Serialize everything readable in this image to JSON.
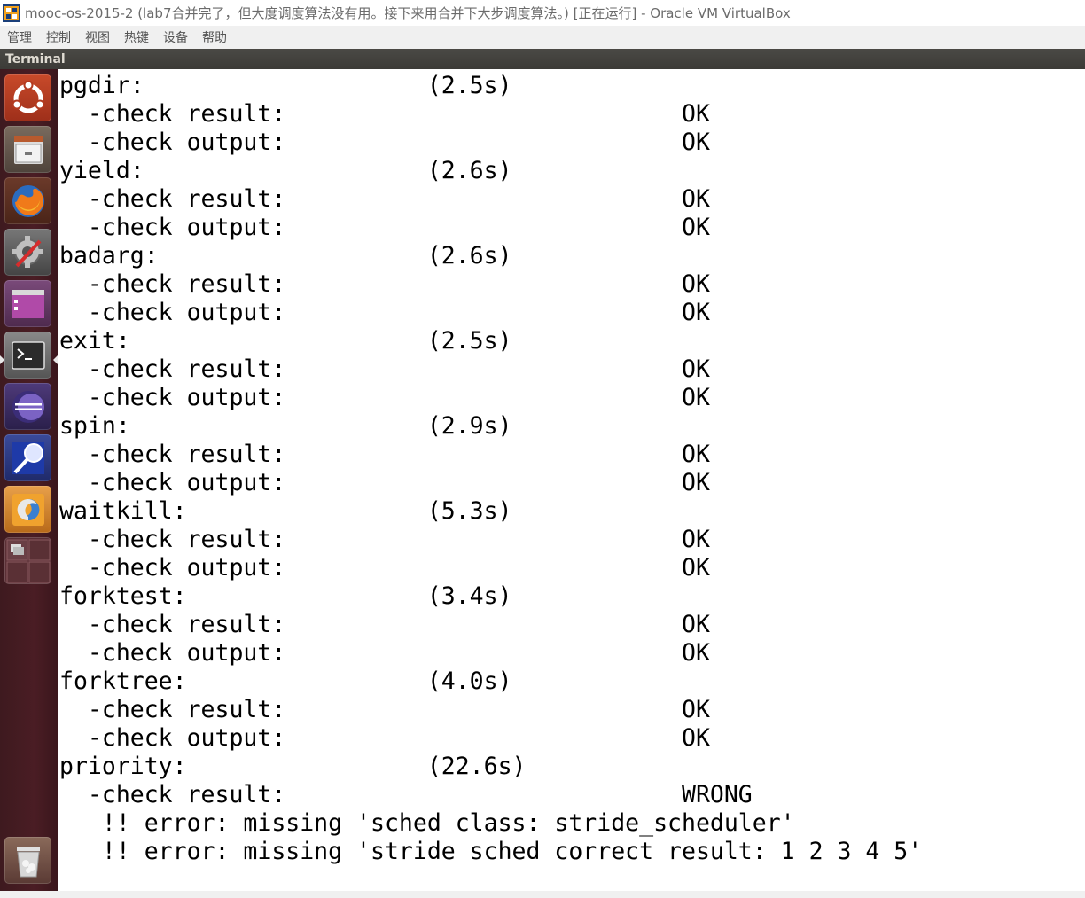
{
  "window": {
    "title": "mooc-os-2015-2 (lab7合并完了，但大度调度算法没有用。接下来用合并下大步调度算法。) [正在运行] - Oracle VM VirtualBox"
  },
  "menubar": {
    "items": [
      "管理",
      "控制",
      "视图",
      "热键",
      "设备",
      "帮助"
    ]
  },
  "guest": {
    "app_name": "Terminal",
    "launcher": [
      {
        "name": "ubuntu-dash-icon",
        "color": "#dd4814"
      },
      {
        "name": "files-icon",
        "color": "#8a8a8a"
      },
      {
        "name": "firefox-icon",
        "color": "#e66000"
      },
      {
        "name": "system-settings-icon",
        "color": "#7a7a7a"
      },
      {
        "name": "workspace-app-icon",
        "color": "#a33fa0"
      },
      {
        "name": "terminal-icon",
        "color": "#2e2e2e"
      },
      {
        "name": "eclipse-icon",
        "color": "#2c2255"
      },
      {
        "name": "code-search-icon",
        "color": "#2a3c9a"
      },
      {
        "name": "meld-icon",
        "color": "#e9902a"
      },
      {
        "name": "workspace-switcher-icon",
        "color": "#5a3a3e"
      },
      {
        "name": "trash-icon",
        "color": "#bbbbbb"
      }
    ]
  },
  "terminal": {
    "lines": [
      "pgdir:                    (2.5s)",
      "  -check result:                            OK",
      "  -check output:                            OK",
      "yield:                    (2.6s)",
      "  -check result:                            OK",
      "  -check output:                            OK",
      "badarg:                   (2.6s)",
      "  -check result:                            OK",
      "  -check output:                            OK",
      "exit:                     (2.5s)",
      "  -check result:                            OK",
      "  -check output:                            OK",
      "spin:                     (2.9s)",
      "  -check result:                            OK",
      "  -check output:                            OK",
      "waitkill:                 (5.3s)",
      "  -check result:                            OK",
      "  -check output:                            OK",
      "forktest:                 (3.4s)",
      "  -check result:                            OK",
      "  -check output:                            OK",
      "forktree:                 (4.0s)",
      "  -check result:                            OK",
      "  -check output:                            OK",
      "priority:                 (22.6s)",
      "  -check result:                            WRONG",
      "   !! error: missing 'sched class: stride_scheduler'",
      "   !! error: missing 'stride sched correct result: 1 2 3 4 5'"
    ]
  }
}
